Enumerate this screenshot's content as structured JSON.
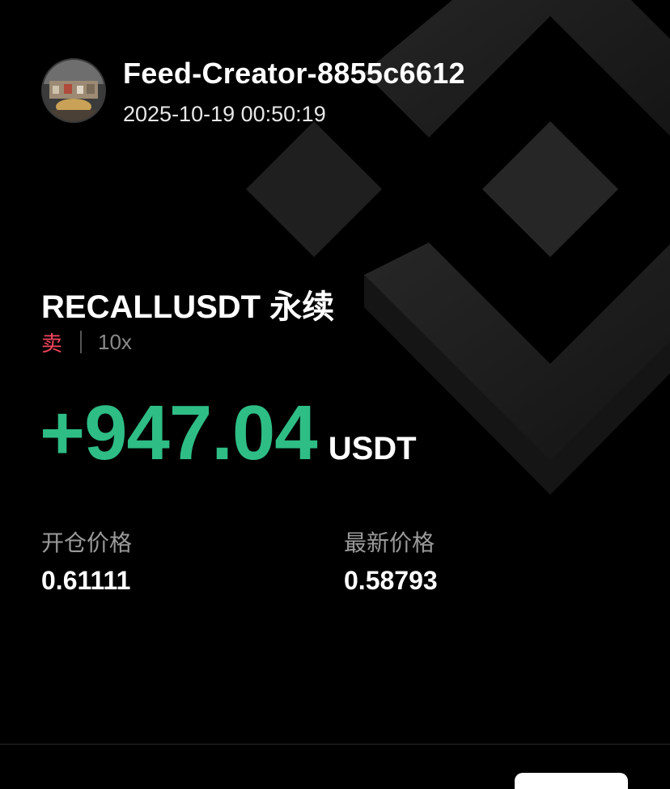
{
  "header": {
    "username": "Feed-Creator-8855c6612",
    "timestamp": "2025-10-19 00:50:19"
  },
  "position": {
    "symbol": "RECALLUSDT 永续",
    "side": "卖",
    "leverage": "10x"
  },
  "pnl": {
    "value": "+947.04",
    "unit": "USDT"
  },
  "prices": {
    "entry_label": "开仓价格",
    "entry_value": "0.61111",
    "latest_label": "最新价格",
    "latest_value": "0.58793"
  },
  "colors": {
    "profit": "#2ebd85",
    "sell": "#f6465d",
    "background": "#000000"
  },
  "icons": {
    "background_logo": "binance-logo-icon",
    "avatar": "user-avatar"
  }
}
